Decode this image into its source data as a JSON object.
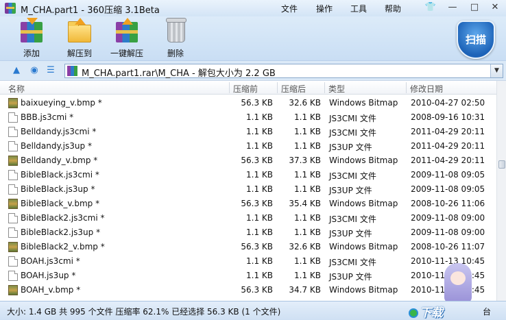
{
  "window": {
    "title": "M_CHA.part1 - 360压缩 3.1Beta",
    "menu": [
      "文件",
      "操作",
      "工具",
      "帮助"
    ],
    "controls": [
      "—",
      "□",
      "✕"
    ]
  },
  "toolbar": {
    "add": "添加",
    "extract_to": "解压到",
    "one_click": "一键解压",
    "delete": "删除",
    "scan": "扫描"
  },
  "address": {
    "path": "M_CHA.part1.rar\\M_CHA - 解包大小为 2.2 GB"
  },
  "columns": {
    "name": "名称",
    "packed": "压缩前",
    "unpacked": "压缩后",
    "type": "类型",
    "modified": "修改日期"
  },
  "files": [
    {
      "icon": "bmp",
      "name": "baixueying_v.bmp *",
      "packed": "56.3 KB",
      "unpacked": "32.6 KB",
      "type": "Windows Bitmap",
      "modified": "2010-04-27 02:50"
    },
    {
      "icon": "doc",
      "name": "BBB.js3cmi *",
      "packed": "1.1 KB",
      "unpacked": "1.1 KB",
      "type": "JS3CMI 文件",
      "modified": "2008-09-16 10:31"
    },
    {
      "icon": "doc",
      "name": "Belldandy.js3cmi *",
      "packed": "1.1 KB",
      "unpacked": "1.1 KB",
      "type": "JS3CMI 文件",
      "modified": "2011-04-29 20:11"
    },
    {
      "icon": "doc",
      "name": "Belldandy.js3up *",
      "packed": "1.1 KB",
      "unpacked": "1.1 KB",
      "type": "JS3UP 文件",
      "modified": "2011-04-29 20:11"
    },
    {
      "icon": "bmp",
      "name": "Belldandy_v.bmp *",
      "packed": "56.3 KB",
      "unpacked": "37.3 KB",
      "type": "Windows Bitmap",
      "modified": "2011-04-29 20:11"
    },
    {
      "icon": "doc",
      "name": "BibleBlack.js3cmi *",
      "packed": "1.1 KB",
      "unpacked": "1.1 KB",
      "type": "JS3CMI 文件",
      "modified": "2009-11-08 09:05"
    },
    {
      "icon": "doc",
      "name": "BibleBlack.js3up *",
      "packed": "1.1 KB",
      "unpacked": "1.1 KB",
      "type": "JS3UP 文件",
      "modified": "2009-11-08 09:05"
    },
    {
      "icon": "bmp",
      "name": "BibleBlack_v.bmp *",
      "packed": "56.3 KB",
      "unpacked": "35.4 KB",
      "type": "Windows Bitmap",
      "modified": "2008-10-26 11:06"
    },
    {
      "icon": "doc",
      "name": "BibleBlack2.js3cmi *",
      "packed": "1.1 KB",
      "unpacked": "1.1 KB",
      "type": "JS3CMI 文件",
      "modified": "2009-11-08 09:00"
    },
    {
      "icon": "doc",
      "name": "BibleBlack2.js3up *",
      "packed": "1.1 KB",
      "unpacked": "1.1 KB",
      "type": "JS3UP 文件",
      "modified": "2009-11-08 09:00"
    },
    {
      "icon": "bmp",
      "name": "BibleBlack2_v.bmp *",
      "packed": "56.3 KB",
      "unpacked": "32.6 KB",
      "type": "Windows Bitmap",
      "modified": "2008-10-26 11:07"
    },
    {
      "icon": "doc",
      "name": "BOAH.js3cmi *",
      "packed": "1.1 KB",
      "unpacked": "1.1 KB",
      "type": "JS3CMI 文件",
      "modified": "2010-11-13 10:45"
    },
    {
      "icon": "doc",
      "name": "BOAH.js3up *",
      "packed": "1.1 KB",
      "unpacked": "1.1 KB",
      "type": "JS3UP 文件",
      "modified": "2010-11-13 10:45"
    },
    {
      "icon": "bmp",
      "name": "BOAH_v.bmp *",
      "packed": "56.3 KB",
      "unpacked": "34.7 KB",
      "type": "Windows Bitmap",
      "modified": "2010-11-13 10:45"
    }
  ],
  "status": {
    "text": "大小: 1.4 GB 共 995 个文件 压缩率 62.1% 已经选择 56.3 KB (1 个文件)",
    "watermark": "下载",
    "tail": "台"
  }
}
